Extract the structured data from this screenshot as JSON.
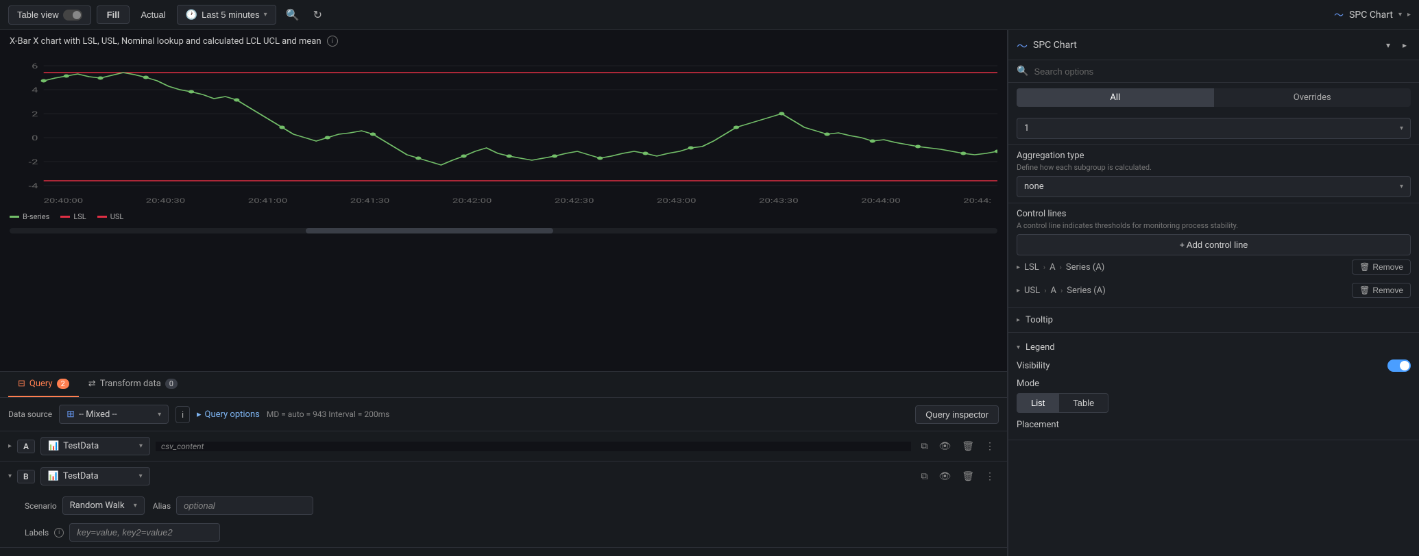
{
  "toolbar": {
    "table_view_label": "Table view",
    "fill_label": "Fill",
    "actual_label": "Actual",
    "time_range_label": "Last 5 minutes",
    "panel_title": "SPC Chart"
  },
  "chart": {
    "title": "X-Bar X chart with LSL, USL, Nominal lookup and calculated LCL UCL and mean",
    "y_labels": [
      "6",
      "4",
      "2",
      "0",
      "-2",
      "-4"
    ],
    "x_labels": [
      "20:40:00",
      "20:40:30",
      "20:41:00",
      "20:41:30",
      "20:42:00",
      "20:42:30",
      "20:43:00",
      "20:43:30",
      "20:44:00",
      "20:44:"
    ],
    "legend": [
      {
        "label": "B-series",
        "color": "#73bf69"
      },
      {
        "label": "LSL",
        "color": "#e02f44"
      },
      {
        "label": "USL",
        "color": "#e02f44"
      }
    ]
  },
  "query_editor": {
    "tabs": [
      {
        "label": "Query",
        "badge": "2",
        "active": true
      },
      {
        "label": "Transform data",
        "badge": "0",
        "active": false
      }
    ],
    "data_source_label": "Data source",
    "data_source_value": "-- Mixed --",
    "query_options_label": "Query options",
    "query_meta": "MD = auto = 943   Interval = 200ms",
    "query_inspector_label": "Query inspector",
    "queries": [
      {
        "letter": "A",
        "datasource": "TestData",
        "field_placeholder": "csv_content",
        "collapsed": true
      },
      {
        "letter": "B",
        "datasource": "TestData",
        "collapsed": false,
        "scenario_label": "Scenario",
        "scenario_value": "Random Walk",
        "alias_label": "Alias",
        "alias_placeholder": "optional",
        "labels_label": "Labels",
        "labels_placeholder": "key=value, key2=value2"
      }
    ]
  },
  "right_panel": {
    "title": "SPC Chart",
    "search_placeholder": "Search options",
    "tabs": [
      "All",
      "Overrides"
    ],
    "active_tab": "All",
    "dropdown_value": "1",
    "aggregation": {
      "label": "Aggregation type",
      "description": "Define how each subgroup is calculated.",
      "value": "none"
    },
    "control_lines": {
      "label": "Control lines",
      "description": "A control line indicates thresholds for monitoring process stability.",
      "add_btn": "+ Add control line",
      "items": [
        {
          "path": "LSL > A > Series (A)",
          "remove": "Remove"
        },
        {
          "path": "USL > A > Series (A)",
          "remove": "Remove"
        }
      ]
    },
    "tooltip": {
      "label": "Tooltip",
      "expanded": false
    },
    "legend": {
      "label": "Legend",
      "expanded": true,
      "visibility_label": "Visibility",
      "mode_label": "Mode",
      "mode_options": [
        "List",
        "Table"
      ],
      "active_mode": "List",
      "placement_label": "Placement"
    }
  }
}
